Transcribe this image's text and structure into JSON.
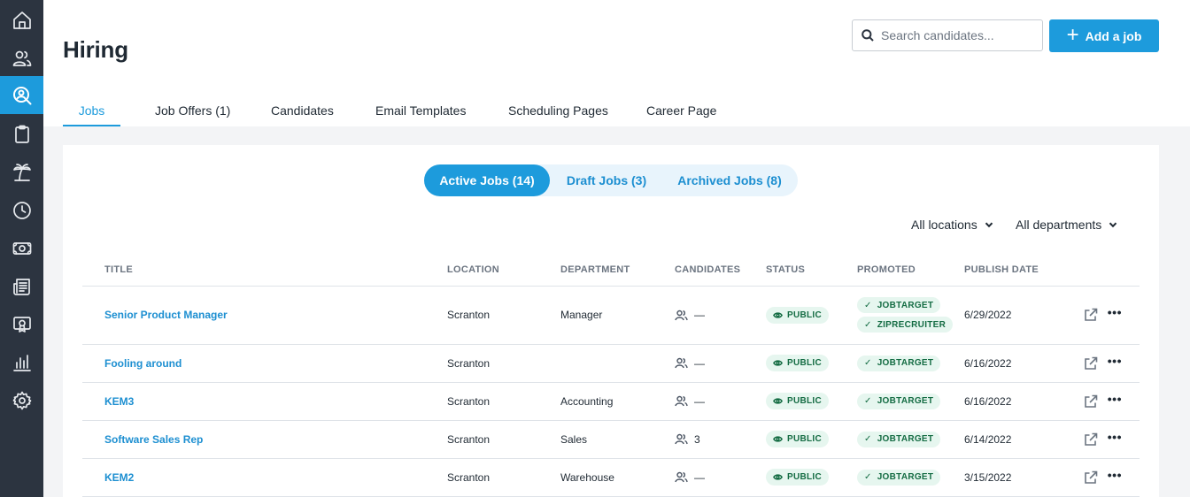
{
  "sidebar": {
    "items": [
      {
        "icon": "home-icon",
        "active": false
      },
      {
        "icon": "people-icon",
        "active": false
      },
      {
        "icon": "hiring-search-icon",
        "active": true
      },
      {
        "icon": "clipboard-icon",
        "active": false
      },
      {
        "icon": "palm-tree-icon",
        "active": false
      },
      {
        "icon": "clock-icon",
        "active": false
      },
      {
        "icon": "money-icon",
        "active": false
      },
      {
        "icon": "newspaper-icon",
        "active": false
      },
      {
        "icon": "certificate-icon",
        "active": false
      },
      {
        "icon": "bar-chart-icon",
        "active": false
      },
      {
        "icon": "gear-icon",
        "active": false
      }
    ]
  },
  "header": {
    "title": "Hiring",
    "search_placeholder": "Search candidates...",
    "add_job_label": "Add a job",
    "tabs": [
      {
        "label": "Jobs",
        "active": true
      },
      {
        "label": "Job Offers (1)",
        "active": false
      },
      {
        "label": "Candidates",
        "active": false
      },
      {
        "label": "Email Templates",
        "active": false
      },
      {
        "label": "Scheduling Pages",
        "active": false
      },
      {
        "label": "Career Page",
        "active": false
      }
    ]
  },
  "jobs_view": {
    "segments": [
      {
        "label": "Active Jobs (14)",
        "active": true
      },
      {
        "label": "Draft Jobs (3)",
        "active": false
      },
      {
        "label": "Archived Jobs (8)",
        "active": false
      }
    ],
    "filters": {
      "locations": "All locations",
      "departments": "All departments"
    },
    "columns": {
      "title": "TITLE",
      "location": "LOCATION",
      "department": "DEPARTMENT",
      "candidates": "CANDIDATES",
      "status": "STATUS",
      "promoted": "PROMOTED",
      "publish_date": "PUBLISH DATE"
    },
    "rows": [
      {
        "title": "Senior Product Manager",
        "location": "Scranton",
        "department": "Manager",
        "candidates": "—",
        "status": "PUBLIC",
        "promoted": [
          "JOBTARGET",
          "ZIPRECRUITER"
        ],
        "publish_date": "6/29/2022"
      },
      {
        "title": "Fooling around",
        "location": "Scranton",
        "department": "",
        "candidates": "—",
        "status": "PUBLIC",
        "promoted": [
          "JOBTARGET"
        ],
        "publish_date": "6/16/2022"
      },
      {
        "title": "KEM3",
        "location": "Scranton",
        "department": "Accounting",
        "candidates": "—",
        "status": "PUBLIC",
        "promoted": [
          "JOBTARGET"
        ],
        "publish_date": "6/16/2022"
      },
      {
        "title": "Software Sales Rep",
        "location": "Scranton",
        "department": "Sales",
        "candidates": "3",
        "status": "PUBLIC",
        "promoted": [
          "JOBTARGET"
        ],
        "publish_date": "6/14/2022"
      },
      {
        "title": "KEM2",
        "location": "Scranton",
        "department": "Warehouse",
        "candidates": "—",
        "status": "PUBLIC",
        "promoted": [
          "JOBTARGET"
        ],
        "publish_date": "3/15/2022"
      }
    ]
  },
  "colors": {
    "sidebar_bg": "#2c3440",
    "accent": "#1d9bdc",
    "success_bg": "#e6f6ef",
    "success_text": "#146c43"
  }
}
